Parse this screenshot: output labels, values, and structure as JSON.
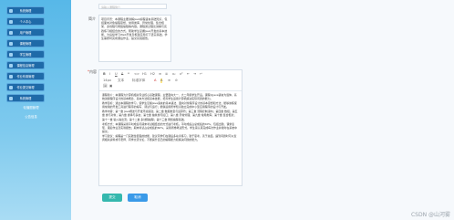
{
  "sidebar": {
    "items": [
      {
        "label": "系统管理"
      },
      {
        "label": "个人中心"
      },
      {
        "label": "用户管理"
      },
      {
        "label": "课程管理"
      },
      {
        "label": "学生管理"
      },
      {
        "label": "课程信息管理"
      },
      {
        "label": "作业布置管理"
      },
      {
        "label": "作业提交管理"
      },
      {
        "label": "系统管理"
      }
    ],
    "sub_items": [
      {
        "label": "轮播图管理"
      },
      {
        "label": "公告信息"
      }
    ]
  },
  "form": {
    "top_input_placeholder": "请输入课程简介",
    "intro_label": "简介",
    "intro_text": "项目背景：本课程主要讲解Java编程语言基础知识，包括面向对象编程思想、常用类库、异常处理、集合框架、多线程与网络编程等内容。课程通过理论讲解与实践练习相结合的方式，帮助学生掌握Java开发的基本技能，为后续学习Web开发及框架应用打下坚实基础。学生需按时完成课后作业，提交实验报告。",
    "content_label": "内容",
    "content_required_mark": "*",
    "toolbar_row1": [
      "B",
      "I",
      "U",
      "S",
      "❝",
      "<>",
      "H1",
      "H2",
      "≡",
      "≣",
      "x₂",
      "x²",
      "⇤",
      "⇥",
      "↵"
    ],
    "toolbar_row2": [
      "14px",
      "文本",
      "标准字体",
      "A",
      "A",
      "≡",
      "⊘"
    ],
    "toolbar_row3": [
      "🖼",
      "▣"
    ],
    "content_paragraphs": [
      "课程简介：本课程为计算机相关专业核心基础课程，主要面向大一、大二年级学生开设。课程以Java语言为载体，系统讲授程序设计的基本概念、基本方法和基本技能，培养学生运用计算机解决实际问题的能力。",
      "教学目标：通过本课程的学习，使学生掌握Java语言的基本语法、面向对象程序设计的基本思想和方法；能够熟练使用常用的开发工具进行程序的编写、调试与运行；能够运用所学知识独立完成中小型应用程序的设计与开发。",
      "教学内容：第一章 Java概述与开发环境搭建；第二章 数据类型与运算符；第三章 流程控制语句；第四章 数组；第五章 类与对象；第六章 继承与多态；第七章 抽象类与接口；第八章 异常处理；第九章 常用类库；第十章 集合框架；第十一章 输入输出流；第十二章 多线程编程；第十三章 网络编程基础。",
      "考核方式：本课程采用平时成绩与期末考试相结合的方式进行考核。平时成绩占总成绩的40%，包括出勤、课堂表现、课后作业及实验报告；期末考试占总成绩的60%，采用闭卷笔试形式。学生需认真完成每次作业并按时在系统中提交。",
      "学习建议：编程是一门实践性很强的技能，建议同学们在课后多动手练习，勤于思考，善于总结。遇到问题时可以查阅相关资料或与老师、同学交流讨论，不断提升自己的编程能力和解决问题的能力。"
    ]
  },
  "buttons": {
    "submit_label": "提交",
    "cancel_label": "取消"
  },
  "watermark": "CSDN @山河雾"
}
